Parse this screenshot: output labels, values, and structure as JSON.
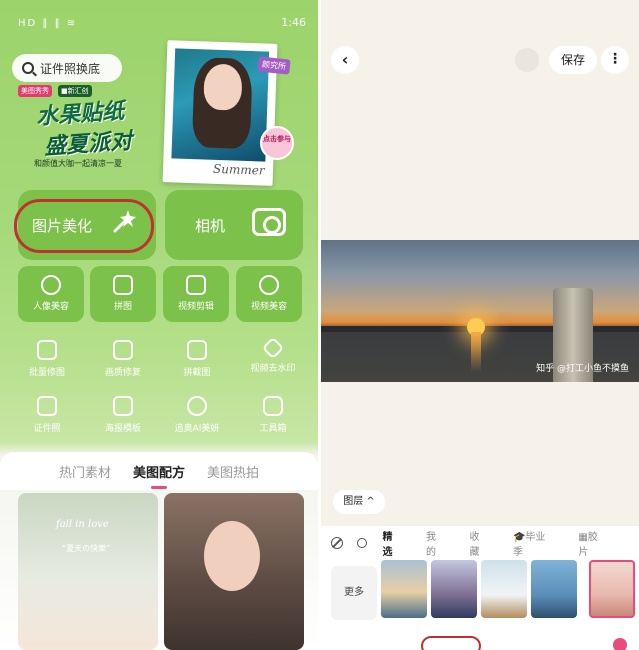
{
  "left": {
    "status": {
      "signal": "HD ‖ ‖ ≋",
      "time": "1:46"
    },
    "search": {
      "text": "证件照换底"
    },
    "banner": {
      "brand1": "美图秀秀",
      "brand2": "■新汇创",
      "title_line1": "水果贴纸",
      "title_line2": "盛夏派对",
      "subtitle": "和颜值大咖一起清凉一夏",
      "tag": "颜究所",
      "join": "点击参与",
      "summer": "Summer"
    },
    "big_buttons": [
      {
        "label": "图片美化"
      },
      {
        "label": "相机"
      }
    ],
    "tiles": [
      {
        "label": "人像美容"
      },
      {
        "label": "拼图"
      },
      {
        "label": "视频剪辑"
      },
      {
        "label": "视频美容"
      }
    ],
    "tools_row1": [
      {
        "label": "批量修图"
      },
      {
        "label": "画质修复"
      },
      {
        "label": "拼截图"
      },
      {
        "label": "视频去水印"
      }
    ],
    "tools_row2": [
      {
        "label": "证件照"
      },
      {
        "label": "海报模板"
      },
      {
        "label": "追奥AI美妍"
      },
      {
        "label": "工具箱"
      }
    ],
    "tabs": [
      "热门素材",
      "美图配方",
      "美图热拍"
    ],
    "card1": {
      "line1": "fall in love",
      "line2": "“夏天の快樂”"
    }
  },
  "right": {
    "save_label": "保存",
    "more_label": "⋮",
    "back_label": "‹",
    "watermark": "知乎 @打工小鱼不摸鱼",
    "layer_label": "图层 ^",
    "filter_tabs": [
      "精选",
      "我的",
      "收藏",
      "🎓毕业季",
      "▦胶片"
    ],
    "more_thumb": "更多"
  }
}
